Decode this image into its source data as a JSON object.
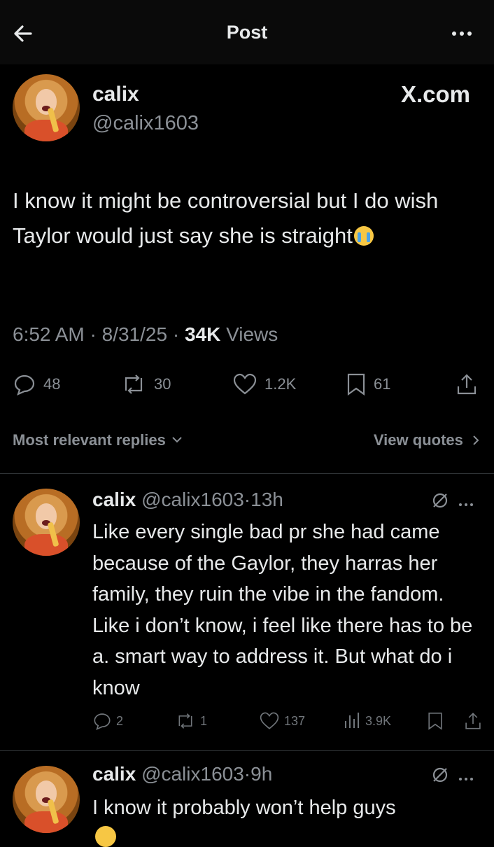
{
  "header": {
    "title": "Post"
  },
  "main_post": {
    "author_name": "calix",
    "author_handle": "@calix1603",
    "brand": "X.com",
    "text": "I know it might be controversial but I do wish Taylor would just say she is straight",
    "time": "6:52 AM",
    "date": "8/31/25",
    "views_count": "34K",
    "views_label": "Views",
    "replies": "48",
    "reposts": "30",
    "likes": "1.2K",
    "bookmarks": "61"
  },
  "sort": {
    "label": "Most relevant replies",
    "view_quotes": "View quotes"
  },
  "replies": [
    {
      "name": "calix",
      "handle": "@calix1603",
      "time": "13h",
      "text": "Like every single bad pr she had came because of the Gaylor, they harras her family, they ruin the vibe in the fandom. Like i don’t know, i feel like there has to be a. smart way to address it. But what do i know",
      "replies": "2",
      "reposts": "1",
      "likes": "137",
      "views": "3.9K"
    },
    {
      "name": "calix",
      "handle": "@calix1603",
      "time": "9h",
      "text": "I know it probably won’t help guys"
    }
  ],
  "colors": {
    "background": "#000000",
    "text": "#e7e9ea",
    "muted": "#8b9096",
    "divider": "#2f3336"
  }
}
